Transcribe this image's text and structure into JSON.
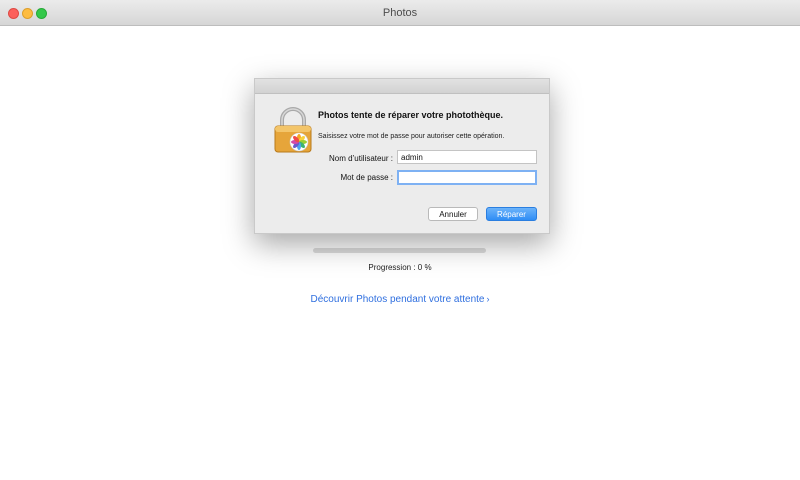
{
  "window": {
    "title": "Photos"
  },
  "dialog": {
    "title": "Photos tente de réparer votre photothèque.",
    "message": "Saisissez votre mot de passe pour autoriser cette opération.",
    "username_label": "Nom d’utilisateur :",
    "username_value": "admin",
    "password_label": "Mot de passe :",
    "password_value": "",
    "cancel_label": "Annuler",
    "repair_label": "Réparer"
  },
  "progress": {
    "value_percent": 0,
    "text": "Progression : 0 %"
  },
  "discover_link": {
    "label": "Découvrir Photos pendant votre attente",
    "chevron": "›"
  },
  "colors": {
    "accent": "#2f8df5",
    "link": "#2f6fdf",
    "close": "#fc605b",
    "minimize": "#fdbc40",
    "maximize": "#34c84a"
  },
  "icons": {
    "dialog_icon": "photos-lock-icon"
  }
}
